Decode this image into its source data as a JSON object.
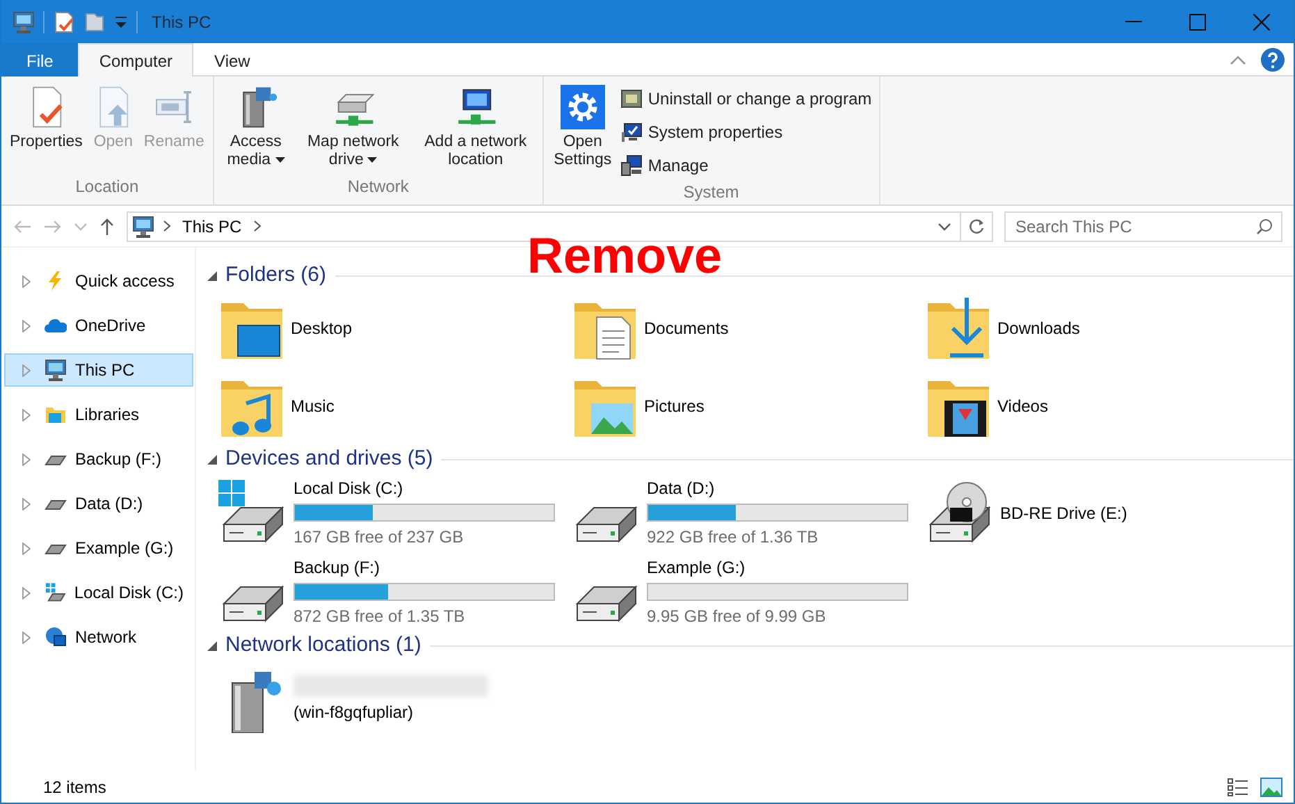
{
  "window": {
    "title": "This PC"
  },
  "ribbon_tabs": [
    {
      "label": "File",
      "kind": "file",
      "selected": false
    },
    {
      "label": "Computer",
      "kind": "tab",
      "selected": true
    },
    {
      "label": "View",
      "kind": "tab",
      "selected": false
    }
  ],
  "ribbon_groups": [
    {
      "label": "Location",
      "buttons": [
        {
          "label": "Properties",
          "kind": "properties",
          "disabled": false,
          "dropdown": false
        },
        {
          "label": "Open",
          "kind": "open",
          "disabled": true,
          "dropdown": false
        },
        {
          "label": "Rename",
          "kind": "rename",
          "disabled": true,
          "dropdown": false
        }
      ]
    },
    {
      "label": "Network",
      "buttons": [
        {
          "label": "Access media",
          "kind": "media",
          "disabled": false,
          "dropdown": true
        },
        {
          "label": "Map network drive",
          "kind": "mapdrive",
          "disabled": false,
          "dropdown": true
        },
        {
          "label": "Add a network location",
          "kind": "netloc",
          "disabled": false,
          "dropdown": false
        }
      ]
    },
    {
      "label": "System",
      "buttons": [
        {
          "label": "Open Settings",
          "kind": "settings",
          "disabled": false,
          "dropdown": false
        }
      ],
      "small_buttons": [
        {
          "label": "Uninstall or change a program",
          "kind": "program"
        },
        {
          "label": "System properties",
          "kind": "sysprops"
        },
        {
          "label": "Manage",
          "kind": "manage"
        }
      ]
    }
  ],
  "address": {
    "path": [
      "This PC"
    ],
    "search_placeholder": "Search This PC"
  },
  "annotation": "Remove",
  "nav_items": [
    {
      "label": "Quick access",
      "kind": "quick",
      "expanded": false,
      "selected": false
    },
    {
      "label": "OneDrive",
      "kind": "cloud",
      "expanded": false,
      "selected": false
    },
    {
      "label": "This PC",
      "kind": "pc",
      "expanded": false,
      "selected": true
    },
    {
      "label": "Libraries",
      "kind": "libraries",
      "expanded": false,
      "selected": false
    },
    {
      "label": "Backup (F:)",
      "kind": "drive",
      "expanded": false,
      "selected": false
    },
    {
      "label": "Data (D:)",
      "kind": "drive",
      "expanded": false,
      "selected": false
    },
    {
      "label": "Example (G:)",
      "kind": "drive",
      "expanded": false,
      "selected": false
    },
    {
      "label": "Local Disk (C:)",
      "kind": "windrive",
      "expanded": false,
      "selected": false
    },
    {
      "label": "Network",
      "kind": "network",
      "expanded": false,
      "selected": false
    }
  ],
  "sections": [
    {
      "title": "Folders (6)",
      "kind": "folders",
      "expanded": true,
      "items": [
        {
          "label": "Desktop",
          "kind": "desktop"
        },
        {
          "label": "Documents",
          "kind": "documents"
        },
        {
          "label": "Downloads",
          "kind": "downloads"
        },
        {
          "label": "Music",
          "kind": "music"
        },
        {
          "label": "Pictures",
          "kind": "pictures"
        },
        {
          "label": "Videos",
          "kind": "videos"
        }
      ]
    },
    {
      "title": "Devices and drives (5)",
      "kind": "drives",
      "expanded": true,
      "items": [
        {
          "label": "Local Disk (C:)",
          "kind": "windrive",
          "level": 0.3,
          "free": "167 GB free of 237 GB"
        },
        {
          "label": "Data (D:)",
          "kind": "drive",
          "level": 0.34,
          "free": "922 GB free of 1.36 TB"
        },
        {
          "label": "BD-RE Drive (E:)",
          "kind": "optical"
        },
        {
          "label": "Backup (F:)",
          "kind": "drive",
          "level": 0.36,
          "free": "872 GB free of 1.35 TB"
        },
        {
          "label": "Example (G:)",
          "kind": "drive",
          "level": 0.0,
          "free": "9.95 GB free of 9.99 GB"
        }
      ]
    },
    {
      "title": "Network locations (1)",
      "kind": "network",
      "expanded": true,
      "items": [
        {
          "label": "(win-f8gqfupliar)",
          "kind": "mediaserver"
        }
      ]
    }
  ],
  "status_bar": {
    "count": "12 items"
  }
}
